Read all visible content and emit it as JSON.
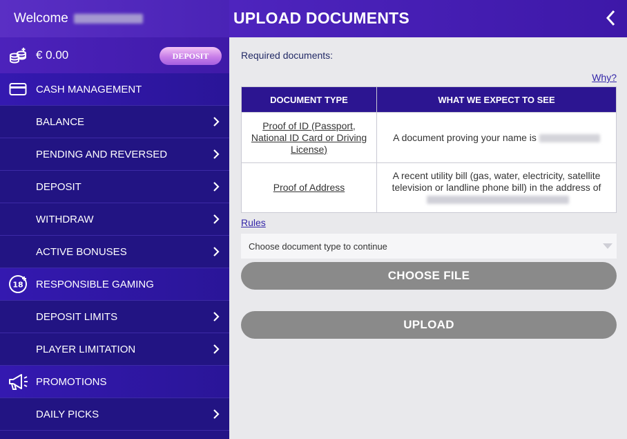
{
  "sidebar": {
    "welcome": "Welcome",
    "balance": "€ 0.00",
    "deposit_button": "DEPOSIT",
    "sections": [
      {
        "label": "CASH MANAGEMENT",
        "icon": "card-icon"
      },
      {
        "label": "RESPONSIBLE GAMING",
        "icon": "18-plus-icon"
      },
      {
        "label": "PROMOTIONS",
        "icon": "megaphone-icon"
      }
    ],
    "cash_items": [
      "BALANCE",
      "PENDING AND REVERSED",
      "DEPOSIT",
      "WITHDRAW",
      "ACTIVE BONUSES"
    ],
    "rg_items": [
      "DEPOSIT LIMITS",
      "PLAYER LIMITATION"
    ],
    "promo_items": [
      "DAILY PICKS"
    ]
  },
  "header": {
    "title": "UPLOAD DOCUMENTS",
    "back_icon": "chevron-left-icon"
  },
  "main": {
    "required_label": "Required documents:",
    "why_link": "Why?",
    "table": {
      "headers": [
        "DOCUMENT TYPE",
        "WHAT WE EXPECT TO SEE"
      ],
      "rows": [
        {
          "type": "Proof of ID (Passport, National ID Card or Driving License)",
          "expect": "A document proving your name is"
        },
        {
          "type": "Proof of Address",
          "expect": "A recent utility bill (gas, water, electricity, satellite television or landline phone bill) in the address of"
        }
      ]
    },
    "rules_link": "Rules",
    "select_placeholder": "Choose document type to continue",
    "choose_file_button": "CHOOSE FILE",
    "upload_button": "UPLOAD"
  },
  "colors": {
    "sidebar_bg": "#241487",
    "header_bg": "#4e24be",
    "table_header": "#2c1591",
    "button_gray": "#8a8a8a",
    "link": "#3326a8"
  }
}
